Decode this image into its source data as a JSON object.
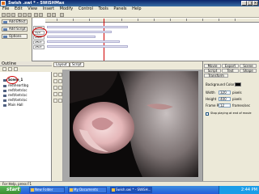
{
  "window": {
    "title": "Swish .swi * - SWiSHMax"
  },
  "menu": [
    "File",
    "Edit",
    "View",
    "Insert",
    "Modify",
    "Control",
    "Tools",
    "Panels",
    "Help"
  ],
  "timeline": {
    "buttons": [
      {
        "label": "Add Effect"
      },
      {
        "label": "Add Script"
      },
      {
        "label": "Options"
      }
    ],
    "layers": [
      "scene",
      "layer",
      "effect",
      "effect",
      "effect"
    ]
  },
  "outline": {
    "title": "Outline",
    "items": [
      "Scene_1",
      "red\\heart\\bg",
      "red\\fonts\\sc",
      "red\\fonts\\sc",
      "red\\fonts\\sc",
      "Main Hall"
    ]
  },
  "stage": {
    "tabs": [
      "Layout",
      "Script"
    ],
    "zoom": "100%"
  },
  "properties": {
    "tabs": [
      "Movie",
      "Export",
      "Scene",
      "Script",
      "Text",
      "Shape",
      "Transform"
    ],
    "bg_color_label": "Background Color",
    "width_label": "Width",
    "width": "320",
    "width_unit": "pixels",
    "height_label": "Height",
    "height": "400",
    "height_unit": "pixels",
    "fps_label": "Frame Rate",
    "fps": "12",
    "fps_unit": "frames/sec",
    "stop_label": "Stop playing at end of movie"
  },
  "status": {
    "text": "For Help, press F1"
  },
  "taskbar": {
    "start": "start",
    "tasks": [
      "New Folder",
      "My Documents",
      "Swish.swi * - SWiSH..."
    ],
    "clock": "2:44 PM"
  }
}
